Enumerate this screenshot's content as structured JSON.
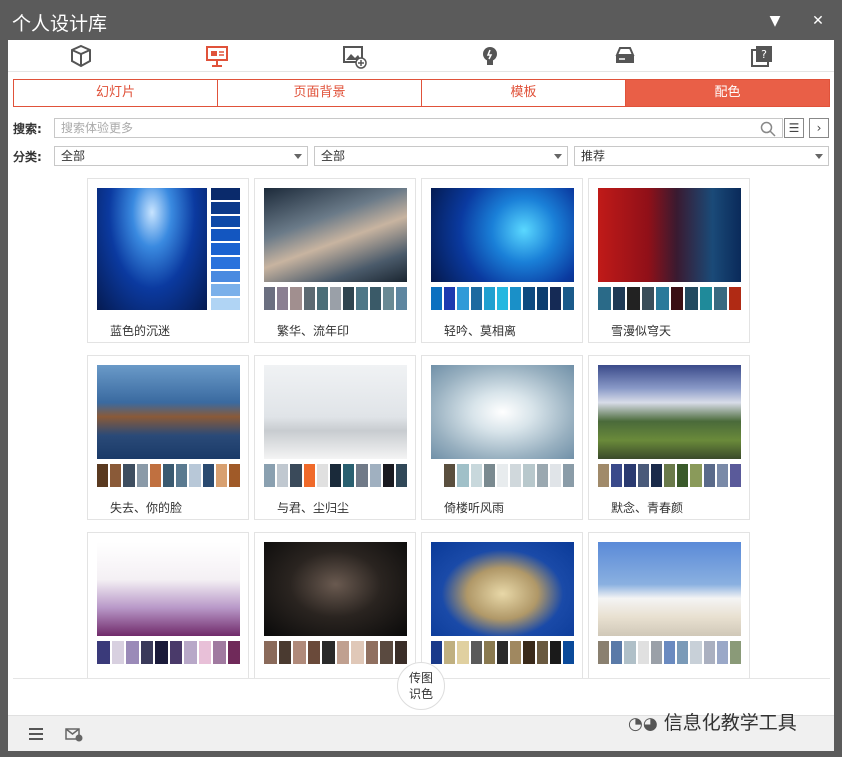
{
  "window": {
    "title": "个人设计库",
    "minimize_icon": "dropdown-arrow-icon",
    "close_icon": "close-icon"
  },
  "categories": [
    {
      "name": "box-icon"
    },
    {
      "name": "slide-presentation-icon",
      "active": true
    },
    {
      "name": "image-add-icon"
    },
    {
      "name": "bulb-icon"
    },
    {
      "name": "drive-icon"
    },
    {
      "name": "help-box-icon"
    }
  ],
  "tabs": [
    {
      "label": "幻灯片"
    },
    {
      "label": "页面背景"
    },
    {
      "label": "模板"
    },
    {
      "label": "配色",
      "active": true
    }
  ],
  "search": {
    "label": "搜索:",
    "placeholder": "搜索体验更多"
  },
  "filter": {
    "label": "分类:",
    "selects": [
      "全部",
      "全部",
      "推荐"
    ]
  },
  "colors": {
    "accent": "#e95f47",
    "title_bar": "#5b5b5b"
  },
  "cards": [
    {
      "name": "蓝色的沉迷",
      "palette": [
        "#0a2a6b",
        "#0c3a8a",
        "#0e4aa8",
        "#1356c0",
        "#1a62d0",
        "#2a72dc",
        "#4a8ae0",
        "#7ab0ea",
        "#b0d4f4"
      ]
    },
    {
      "name": "繁华、流年印",
      "palette": [
        "#6b6f80",
        "#8a7f92",
        "#a18f8f",
        "#5c6a72",
        "#4a6e78",
        "#9aa0a8",
        "#2f4550",
        "#4e7888",
        "#3a5a68",
        "#6a8a94",
        "#5e86a0"
      ]
    },
    {
      "name": "轻吟、莫相离",
      "palette": [
        "#0b70c0",
        "#1d3ab0",
        "#2f9ad8",
        "#1c6aa0",
        "#20a0d0",
        "#25b8e0",
        "#1a90c8",
        "#0d4a80",
        "#0c3f70",
        "#152a55",
        "#1a5a8a"
      ]
    },
    {
      "name": "雪漫似穹天",
      "palette": [
        "#2a6a88",
        "#1f3a55",
        "#222222",
        "#3a4e5a",
        "#2a7a9a",
        "#3a0f14",
        "#234a60",
        "#1f8a9a",
        "#3a6a80",
        "#b02a14"
      ]
    },
    {
      "name": "失去、你的脸",
      "palette": [
        "#5a3a20",
        "#8a5a38",
        "#3e4e60",
        "#8a9aa8",
        "#c07040",
        "#3a5a70",
        "#5a7a90",
        "#b8c8d8",
        "#2a4a70",
        "#d8a070",
        "#a05a28"
      ]
    },
    {
      "name": "与君、尘归尘",
      "palette": [
        "#8aa0b0",
        "#c0c8d0",
        "#3a4a5a",
        "#f06a2a",
        "#e0e0e0",
        "#1a2a3a",
        "#2a6070",
        "#707a88",
        "#a0b0c0",
        "#1a1a20",
        "#304858"
      ]
    },
    {
      "name": "倚楼听风雨",
      "palette": [
        "#ffffff",
        "#5a4f3e",
        "#a0c0c8",
        "#c8d8dc",
        "#7a8a90",
        "#e8ecee",
        "#d0d8dc",
        "#b8c8cc",
        "#9aa8b0",
        "#e0e4e8",
        "#8a9ca8"
      ]
    },
    {
      "name": "默念、青春颜",
      "palette": [
        "#a08a6a",
        "#3a4a8a",
        "#2a3a70",
        "#4a5a7a",
        "#1a2a4a",
        "#6a7a4a",
        "#3a5a2a",
        "#8a9a5a",
        "#5a6a8a",
        "#7a8aa8",
        "#5a5a9a"
      ]
    },
    {
      "name": "",
      "palette": [
        "#3a3a7a",
        "#d8d0e0",
        "#9a8ab8",
        "#3a3a5a",
        "#1a1a3a",
        "#4a3a6a",
        "#b8a8c8",
        "#e8c0d8",
        "#a07aa0",
        "#702a5a"
      ]
    },
    {
      "name": "",
      "palette": [
        "#8a6a5a",
        "#4a3a30",
        "#b08a7a",
        "#6a4a3a",
        "#2a2a2a",
        "#c0a090",
        "#e0c8b8",
        "#907060",
        "#5a4a40",
        "#3a2e28"
      ]
    },
    {
      "name": "",
      "palette": [
        "#1a3a8a",
        "#c0b080",
        "#e0d0a0",
        "#5a5a5a",
        "#8a7a50",
        "#2a2a2a",
        "#a08860",
        "#3a2a1a",
        "#6a5a40",
        "#1a1a1a",
        "#0a4a9a"
      ]
    },
    {
      "name": "",
      "palette": [
        "#8a8070",
        "#5a7aa8",
        "#b0c0c8",
        "#e0e0e0",
        "#9aa0a8",
        "#6a8ac0",
        "#7a9ab8",
        "#c8d0d8",
        "#aab0c0",
        "#9aa8c8",
        "#8a9a78"
      ]
    }
  ],
  "fab": {
    "line1": "传图",
    "line2": "识色"
  },
  "bottom": {
    "menu_icon": "menu-icon",
    "mail_icon": "mail-settings-icon",
    "watermark": "信息化教学工具"
  }
}
